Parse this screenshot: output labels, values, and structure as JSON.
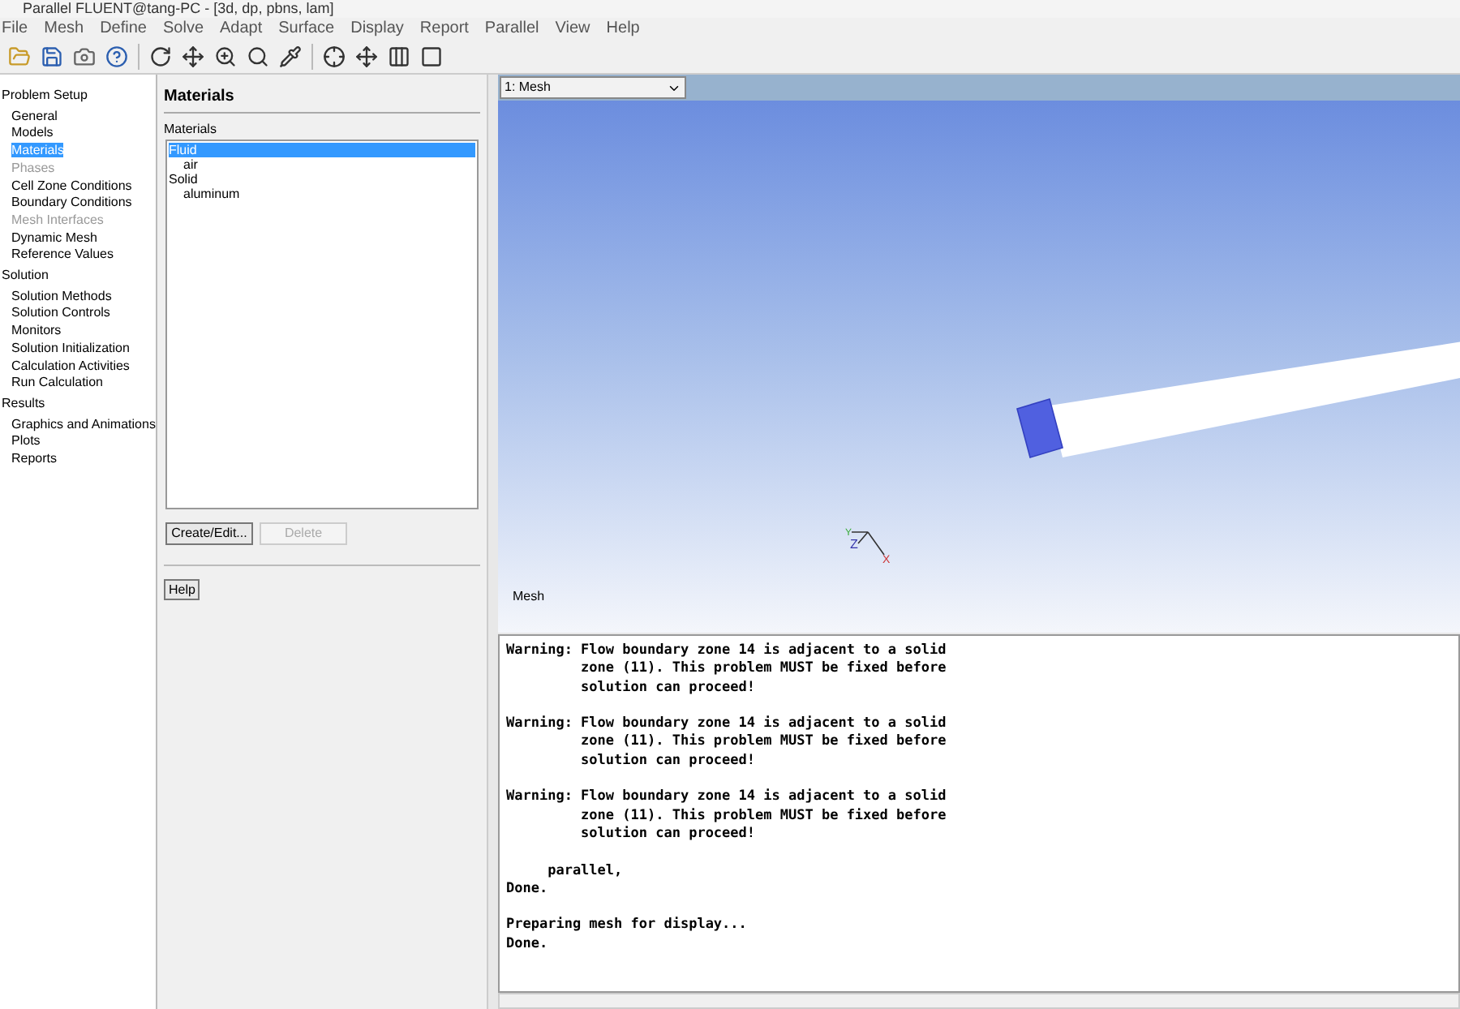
{
  "window": {
    "title": "Parallel FLUENT@tang-PC - [3d, dp, pbns, lam]"
  },
  "menu": [
    "File",
    "Mesh",
    "Define",
    "Solve",
    "Adapt",
    "Surface",
    "Display",
    "Report",
    "Parallel",
    "View",
    "Help"
  ],
  "nav": [
    {
      "label": "Problem Setup",
      "children": [
        {
          "label": "General",
          "selected": false,
          "disabled": false
        },
        {
          "label": "Models",
          "selected": false,
          "disabled": false
        },
        {
          "label": "Materials",
          "selected": true,
          "disabled": false
        },
        {
          "label": "Phases",
          "selected": false,
          "disabled": true
        },
        {
          "label": "Cell Zone Conditions",
          "selected": false,
          "disabled": false
        },
        {
          "label": "Boundary Conditions",
          "selected": false,
          "disabled": false
        },
        {
          "label": "Mesh Interfaces",
          "selected": false,
          "disabled": true
        },
        {
          "label": "Dynamic Mesh",
          "selected": false,
          "disabled": false
        },
        {
          "label": "Reference Values",
          "selected": false,
          "disabled": false
        }
      ]
    },
    {
      "label": "Solution",
      "children": [
        {
          "label": "Solution Methods",
          "selected": false,
          "disabled": false
        },
        {
          "label": "Solution Controls",
          "selected": false,
          "disabled": false
        },
        {
          "label": "Monitors",
          "selected": false,
          "disabled": false
        },
        {
          "label": "Solution Initialization",
          "selected": false,
          "disabled": false
        },
        {
          "label": "Calculation Activities",
          "selected": false,
          "disabled": false
        },
        {
          "label": "Run Calculation",
          "selected": false,
          "disabled": false
        }
      ]
    },
    {
      "label": "Results",
      "children": [
        {
          "label": "Graphics and Animations",
          "selected": false,
          "disabled": false
        },
        {
          "label": "Plots",
          "selected": false,
          "disabled": false
        },
        {
          "label": "Reports",
          "selected": false,
          "disabled": false
        }
      ]
    }
  ],
  "panel": {
    "title": "Materials",
    "list_label": "Materials",
    "materials": [
      {
        "label": "Fluid",
        "selected": true,
        "children": [
          {
            "label": "air",
            "selected": false
          }
        ]
      },
      {
        "label": "Solid",
        "selected": false,
        "children": [
          {
            "label": "aluminum",
            "selected": false
          }
        ]
      }
    ],
    "buttons": [
      {
        "label": "Create/Edit...",
        "disabled": false
      },
      {
        "label": "Delete",
        "disabled": true
      }
    ],
    "help": "Help"
  },
  "graphics": {
    "window_select": "1: Mesh",
    "caption": "Mesh",
    "axes": {
      "y": "Y",
      "z": "Z",
      "x": "X"
    }
  },
  "console": {
    "blocks": [
      [
        "Warning: Flow boundary zone 14 is adjacent to a solid",
        "         zone (11). This problem MUST be fixed before",
        "         solution can proceed!"
      ],
      [
        "Warning: Flow boundary zone 14 is adjacent to a solid",
        "         zone (11). This problem MUST be fixed before",
        "         solution can proceed!"
      ],
      [
        "Warning: Flow boundary zone 14 is adjacent to a solid",
        "         zone (11). This problem MUST be fixed before",
        "         solution can proceed!"
      ],
      [
        "     parallel,",
        "Done."
      ],
      [
        "Preparing mesh for display...",
        "Done."
      ]
    ]
  }
}
